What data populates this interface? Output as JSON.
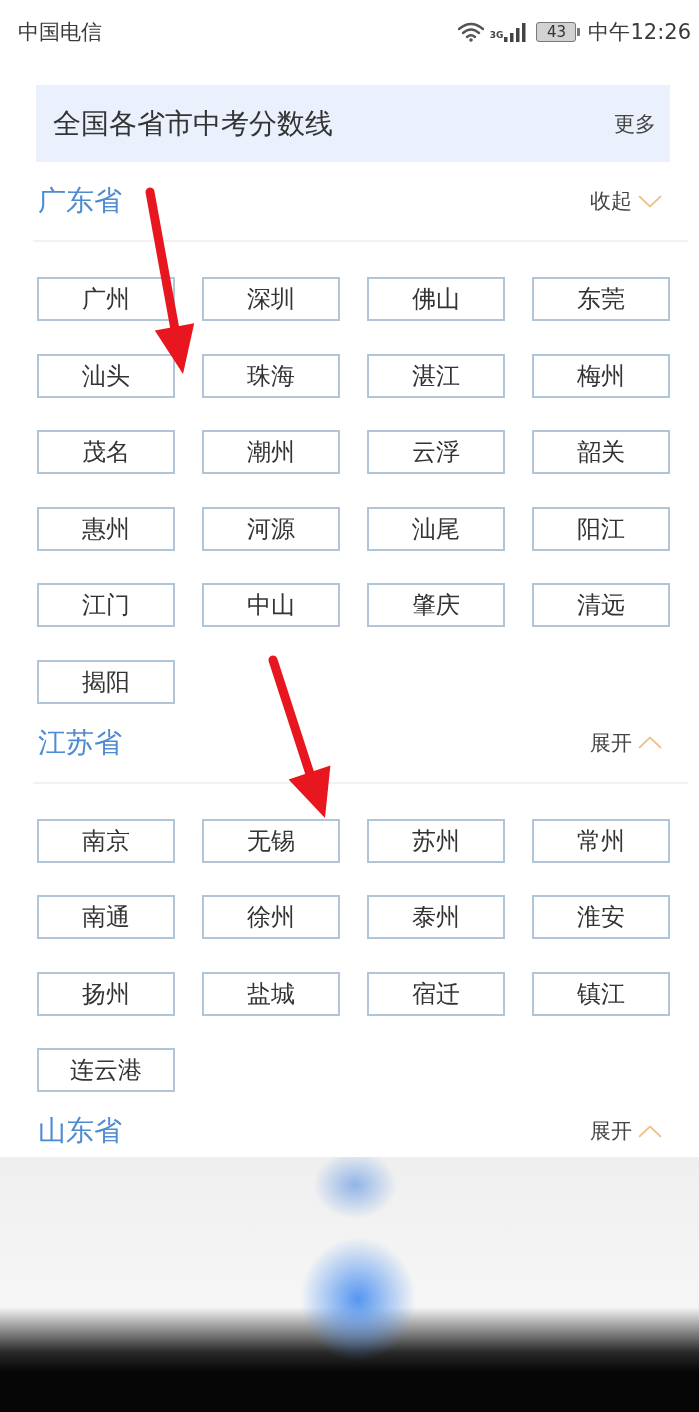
{
  "status_bar": {
    "carrier": "中国电信",
    "network": "3G",
    "battery": "43",
    "time": "中午12:26"
  },
  "header": {
    "title": "全国各省市中考分数线",
    "more": "更多"
  },
  "provinces": [
    {
      "name": "广东省",
      "toggle": "收起",
      "expanded": true,
      "cities": [
        "广州",
        "深圳",
        "佛山",
        "东莞",
        "汕头",
        "珠海",
        "湛江",
        "梅州",
        "茂名",
        "潮州",
        "云浮",
        "韶关",
        "惠州",
        "河源",
        "汕尾",
        "阳江",
        "江门",
        "中山",
        "肇庆",
        "清远",
        "揭阳"
      ]
    },
    {
      "name": "江苏省",
      "toggle": "展开",
      "expanded": false,
      "cities": [
        "南京",
        "无锡",
        "苏州",
        "常州",
        "南通",
        "徐州",
        "泰州",
        "淮安",
        "扬州",
        "盐城",
        "宿迁",
        "镇江",
        "连云港"
      ]
    },
    {
      "name": "山东省",
      "toggle": "展开",
      "expanded": false
    }
  ]
}
